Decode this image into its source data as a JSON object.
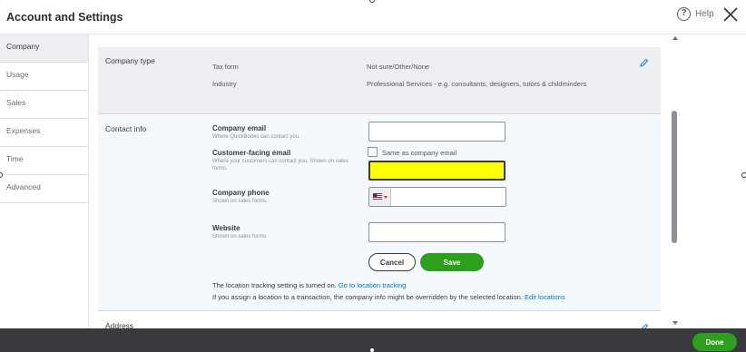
{
  "header": {
    "title": "Account and Settings",
    "help_symbol": "?",
    "help_label": "Help"
  },
  "sidebar": {
    "active": "Company",
    "items": [
      {
        "label": "Company"
      },
      {
        "label": "Usage"
      },
      {
        "label": "Sales"
      },
      {
        "label": "Expenses"
      },
      {
        "label": "Time"
      },
      {
        "label": "Advanced"
      }
    ]
  },
  "company_type": {
    "label": "Company type",
    "rows": [
      {
        "key": "Tax form",
        "value": "Not sure/Other/None"
      },
      {
        "key": "Industry",
        "value": "Professional Services - e.g. consultants, designers, tutors & childminders"
      }
    ]
  },
  "contact_info": {
    "label": "Contact info",
    "company_email": {
      "label": "Company email",
      "hint": "Where QuickBooks can contact you.",
      "value": ""
    },
    "customer_email": {
      "label": "Customer-facing email",
      "hint": "Where your customers can contact you. Shown on sales forms.",
      "checkbox_label": "Same as company email",
      "checked": false,
      "value": "",
      "highlight_color": "#ffff00"
    },
    "company_phone": {
      "label": "Company phone",
      "hint": "Shown on sales forms.",
      "value": ""
    },
    "website": {
      "label": "Website",
      "hint": "Shown on sales forms.",
      "value": ""
    },
    "cancel_label": "Cancel",
    "save_label": "Save",
    "location_note_prefix": "The location tracking setting is turned on.",
    "location_link": "Go to location tracking",
    "override_note": "If you assign a location to a transaction, the company info might be overridden by the selected location.",
    "edit_locations_link": "Edit locations"
  },
  "address": {
    "label": "Address"
  },
  "footer": {
    "done_label": "Done"
  },
  "colors": {
    "accent_green": "#2ca01c",
    "link_blue": "#0077c5",
    "footer_bg": "#393a3d",
    "section_gray": "#eceef1",
    "section_blue": "#f4f9fd"
  }
}
